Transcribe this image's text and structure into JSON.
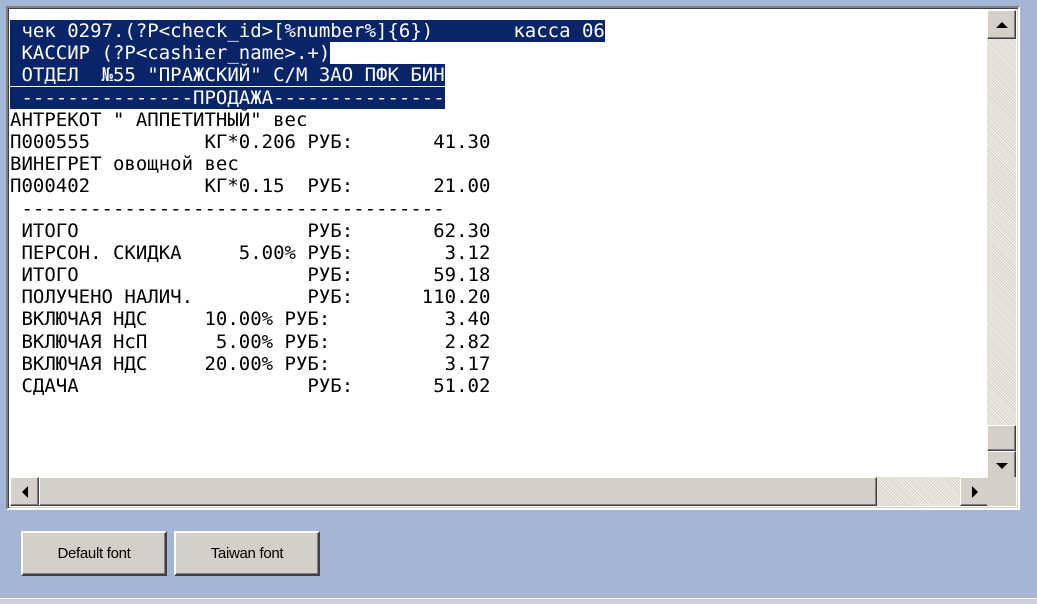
{
  "receipt": {
    "lines": [
      {
        "text": " чек 0297.(?P<check_id>[%number%]{6})       касса 06",
        "selected": true
      },
      {
        "text": " КАССИР (?P<cashier_name>.+)",
        "selected": true
      },
      {
        "text": " ОТДЕЛ  №55 \"ПРАЖСКИЙ\" С/М ЗАО ПФК БИН",
        "selected": true
      },
      {
        "text": " ---------------ПРОДАЖА---------------",
        "selected": true
      },
      {
        "text": "АНТРЕКОТ \" АППЕТИТНЫЙ\" вес",
        "selected": false
      },
      {
        "text": "П000555          КГ*0.206 РУБ:       41.30",
        "selected": false
      },
      {
        "text": "ВИНЕГРЕТ овощной вес",
        "selected": false
      },
      {
        "text": "П000402          КГ*0.15  РУБ:       21.00",
        "selected": false
      },
      {
        "text": " -------------------------------------",
        "selected": false
      },
      {
        "text": " ИТОГО                    РУБ:       62.30",
        "selected": false
      },
      {
        "text": " ПЕРСОН. СКИДКА     5.00% РУБ:        3.12",
        "selected": false
      },
      {
        "text": " ИТОГО                    РУБ:       59.18",
        "selected": false
      },
      {
        "text": " ПОЛУЧЕНО НАЛИЧ.          РУБ:      110.20",
        "selected": false
      },
      {
        "text": " ВКЛЮЧАЯ НДС     10.00% РУБ:          3.40",
        "selected": false
      },
      {
        "text": " ВКЛЮЧАЯ НсП      5.00% РУБ:          2.82",
        "selected": false
      },
      {
        "text": " ВКЛЮЧАЯ НДС     20.00% РУБ:          3.17",
        "selected": false
      },
      {
        "text": " СДАЧА                    РУБ:       51.02",
        "selected": false
      }
    ]
  },
  "buttons": {
    "default_font": "Default font",
    "taiwan_font": "Taiwan font"
  },
  "icons": {
    "scroll_up": "arrow-up-icon",
    "scroll_down": "arrow-down-icon",
    "scroll_left": "arrow-left-icon",
    "scroll_right": "arrow-right-icon"
  },
  "colors": {
    "selection": "#0a246a",
    "background": "#a5b5d6"
  }
}
